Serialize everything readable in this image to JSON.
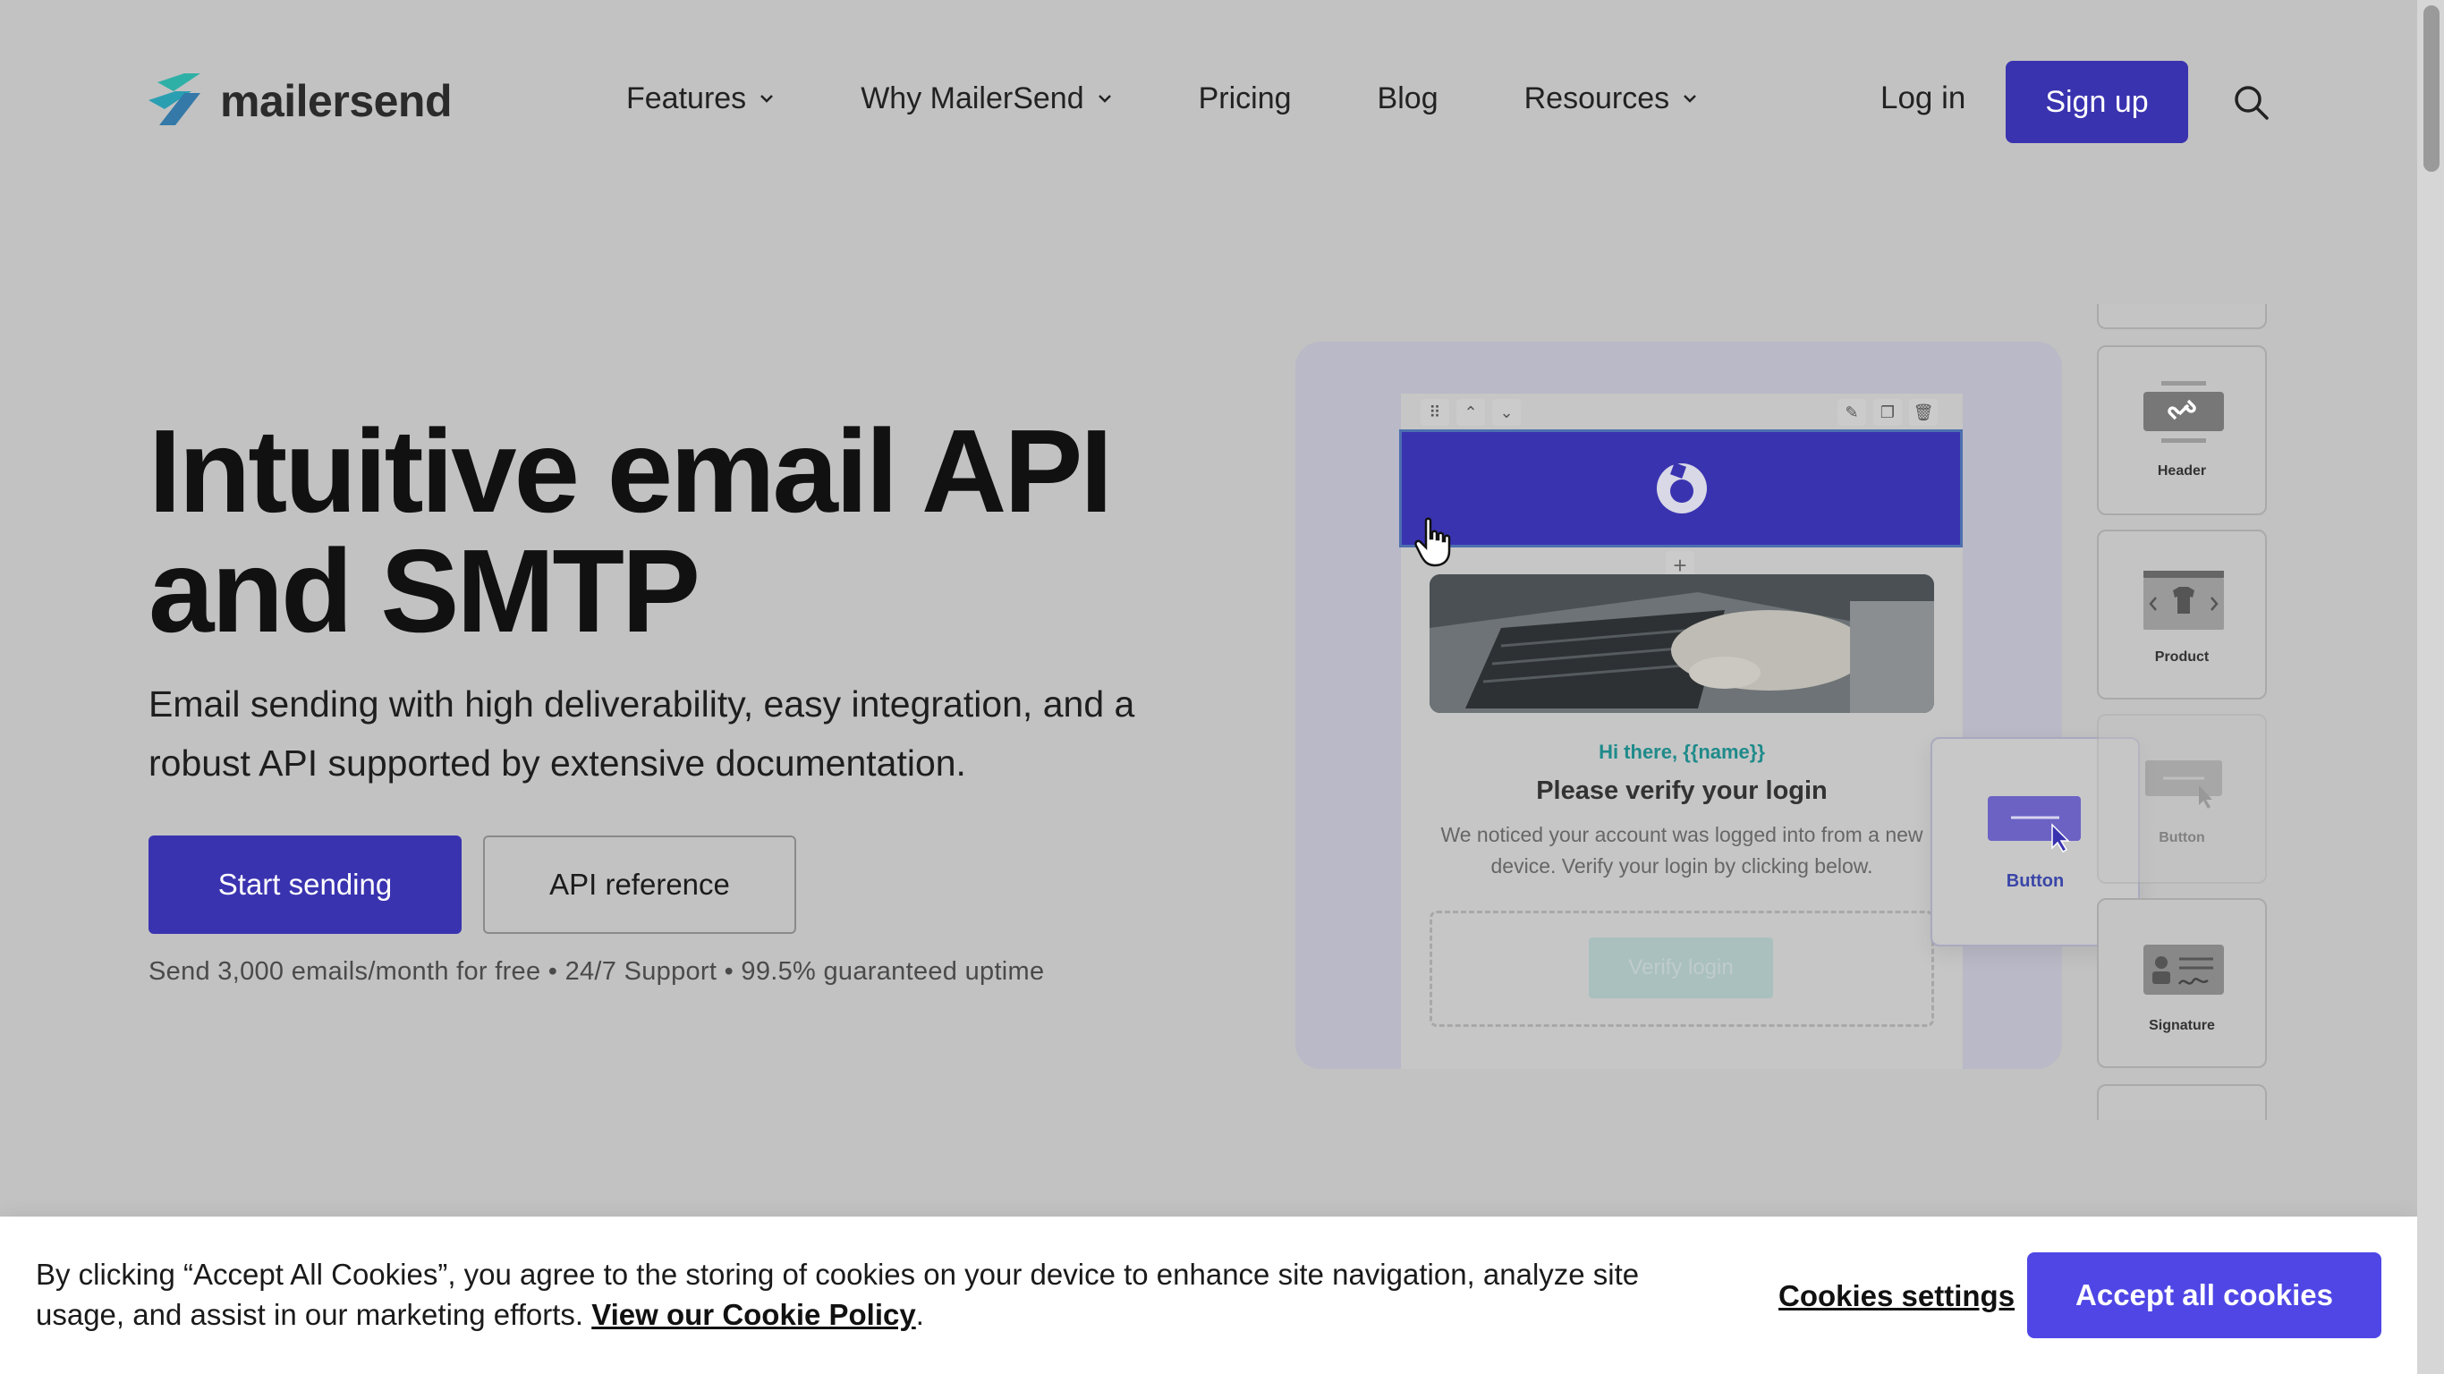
{
  "brand": {
    "name": "mailersend",
    "accent": "#3a33b0",
    "accept_color": "#4f46e5"
  },
  "nav": {
    "items": [
      {
        "label": "Features",
        "has_dropdown": true
      },
      {
        "label": "Why MailerSend",
        "has_dropdown": true
      },
      {
        "label": "Pricing",
        "has_dropdown": false
      },
      {
        "label": "Blog",
        "has_dropdown": false
      },
      {
        "label": "Resources",
        "has_dropdown": true
      }
    ],
    "login": "Log in",
    "signup": "Sign up",
    "search_icon": "search-icon"
  },
  "hero": {
    "title": "Intuitive email API and SMTP",
    "subtitle": "Email sending with high deliverability, easy integration, and a robust API supported by extensive documentation.",
    "primary_cta": "Start sending",
    "secondary_cta": "API reference",
    "tagline": "Send 3,000 emails/month for free • 24/7 Support • 99.5% guaranteed uptime"
  },
  "builder": {
    "greeting": "Hi there, {{name}}",
    "heading": "Please verify your login",
    "body": "We noticed your account was logged into from a new device. Verify your login by clicking below.",
    "verify_button": "Verify login",
    "dragging_block": "Button",
    "blocks": [
      "Header",
      "Product",
      "Button",
      "Signature"
    ]
  },
  "cookie": {
    "text": "By clicking “Accept All Cookies”, you agree to the storing of cookies on your device to enhance site navigation, analyze site usage, and assist in our marketing efforts. ",
    "link": "View our Cookie Policy",
    "after_link": ".",
    "settings": "Cookies settings",
    "accept": "Accept all cookies"
  }
}
